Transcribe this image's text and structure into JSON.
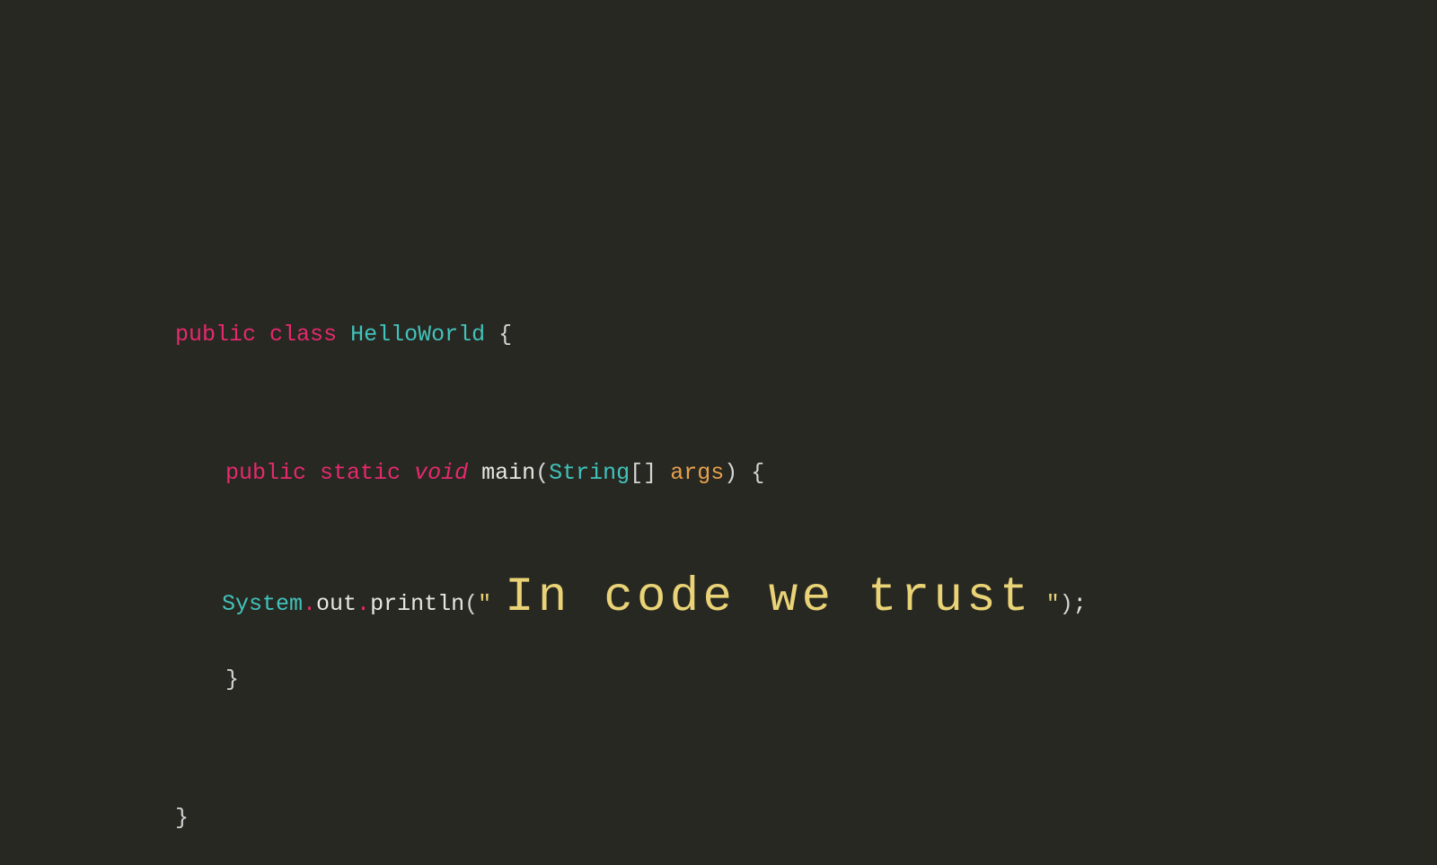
{
  "colors": {
    "background": "#272822",
    "keyword": "#e6296e",
    "type": "#42c3bb",
    "method": "#e8e8e2",
    "param": "#e8a04e",
    "string": "#ead376",
    "plain": "#d4d4d4"
  },
  "code": {
    "line1": {
      "kw_public": "public",
      "kw_class": "class",
      "classname": "HelloWorld",
      "brace_open": " {"
    },
    "line2": {
      "kw_public": "public",
      "kw_static": "static",
      "kw_void": "void",
      "method_name": "main",
      "paren_open": "(",
      "param_type": "String",
      "brackets": "[]",
      "param_name": "args",
      "paren_close": ")",
      "brace_open": " {"
    },
    "line3": {
      "obj_system": "System",
      "dot1": ".",
      "field_out": "out",
      "dot2": ".",
      "method_println": "println",
      "paren_open": "(",
      "quote_open": "\" ",
      "message": "In code we trust",
      "quote_close": " \"",
      "paren_close": ")",
      "semicolon": ";"
    },
    "line4": {
      "brace_close": "}"
    },
    "line5": {
      "brace_close": "}"
    }
  }
}
